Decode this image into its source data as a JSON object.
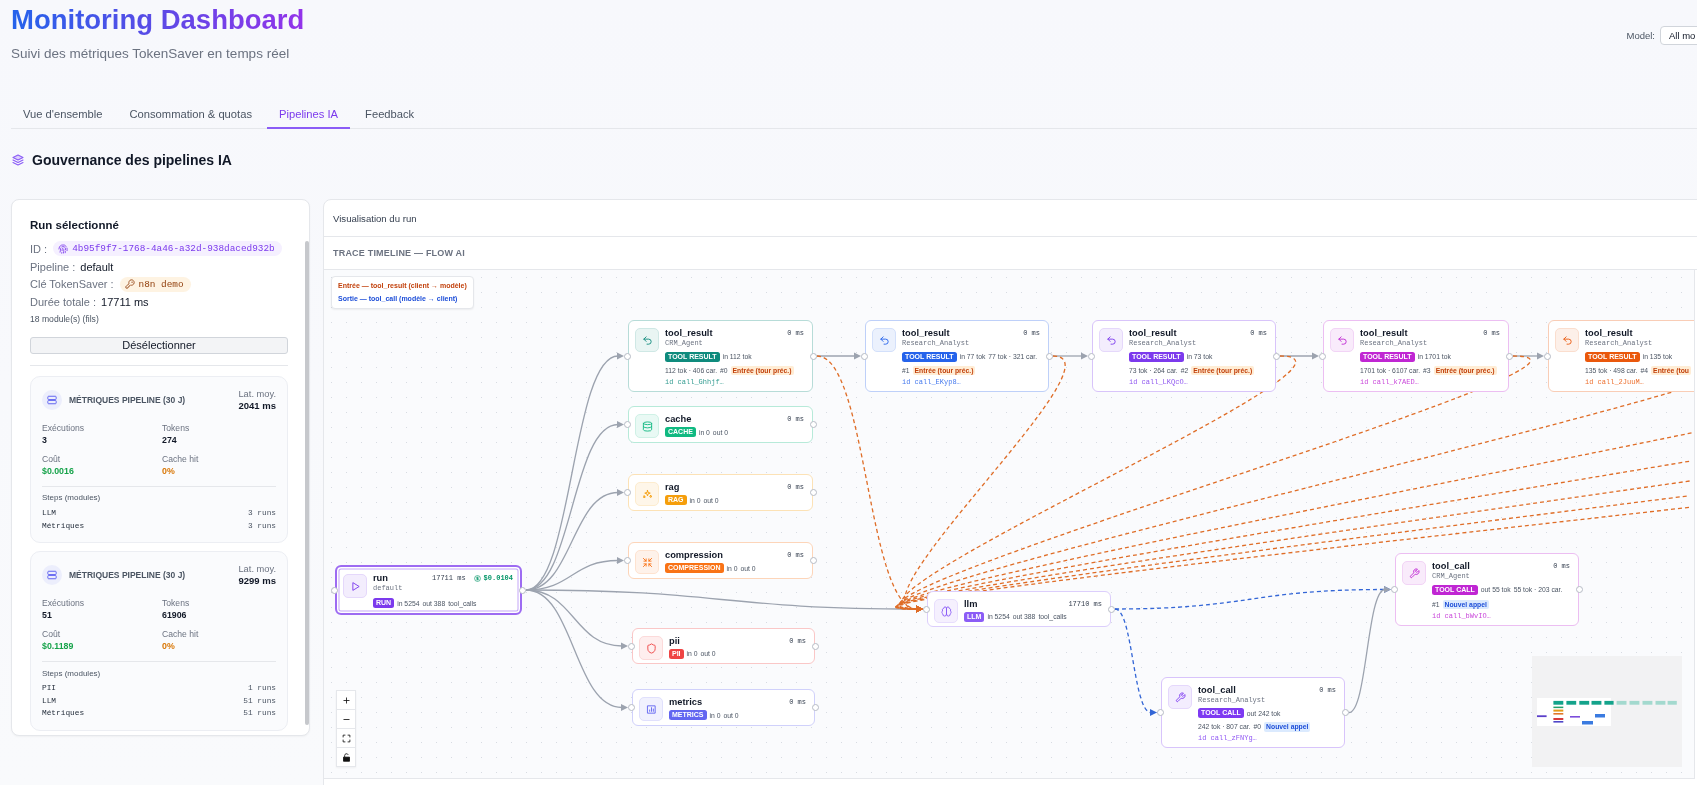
{
  "header": {
    "title": "Monitoring Dashboard",
    "subtitle": "Suivi des métriques TokenSaver en temps réel",
    "model_filter": {
      "label": "Model:",
      "value": "All mo"
    }
  },
  "tabs": [
    {
      "label": "Vue d'ensemble",
      "selected": false
    },
    {
      "label": "Consommation & quotas",
      "selected": false
    },
    {
      "label": "Pipelines IA",
      "selected": true
    },
    {
      "label": "Feedback",
      "selected": false
    }
  ],
  "section": {
    "title": "Gouvernance des pipelines IA"
  },
  "run_panel": {
    "title": "Run sélectionné",
    "fields": [
      {
        "kind": "id",
        "label": "ID :",
        "value": "4b95f9f7-1768-4a46-a32d-938daced932b"
      },
      {
        "kind": "text",
        "label": "Pipeline :",
        "value": "default"
      },
      {
        "kind": "key",
        "label": "Clé TokenSaver :",
        "value": "n8n demo"
      },
      {
        "kind": "text",
        "label": "Durée totale :",
        "value": "17711 ms"
      }
    ],
    "modules_note": "18 module(s) (fils)",
    "deselect_button": "Désélectionner",
    "metric_cards": [
      {
        "title": "MÉTRIQUES PIPELINE (30 J)",
        "latency_label": "Lat. moy.",
        "latency": "2041 ms",
        "stats": [
          {
            "kind": "count",
            "label": "Exécutions",
            "value": "3"
          },
          {
            "kind": "count",
            "label": "Tokens",
            "value": "274"
          },
          {
            "kind": "cost",
            "label": "Coût",
            "value": "$0.0016"
          },
          {
            "kind": "rate",
            "label": "Cache hit",
            "value": "0%"
          }
        ],
        "steps_label": "Steps (modules)",
        "steps": [
          {
            "name": "LLM",
            "runs": "3 runs"
          },
          {
            "name": "Métriques",
            "runs": "3 runs"
          }
        ]
      },
      {
        "title": "MÉTRIQUES PIPELINE (30 J)",
        "latency_label": "Lat. moy.",
        "latency": "9299 ms",
        "stats": [
          {
            "kind": "count",
            "label": "Exécutions",
            "value": "51"
          },
          {
            "kind": "count",
            "label": "Tokens",
            "value": "61906"
          },
          {
            "kind": "cost",
            "label": "Coût",
            "value": "$0.1189"
          },
          {
            "kind": "rate",
            "label": "Cache hit",
            "value": "0%"
          }
        ],
        "steps_label": "Steps (modules)",
        "steps": [
          {
            "name": "PII",
            "runs": "1 runs"
          },
          {
            "name": "LLM",
            "runs": "51 runs"
          },
          {
            "name": "Métriques",
            "runs": "51 runs"
          }
        ]
      }
    ]
  },
  "viz_panel": {
    "title": "Visualisation du run",
    "trace_title": "TRACE TIMELINE — FLOW AI",
    "legend": [
      {
        "kind": "input",
        "text": "Entrée — tool_result (client → modèle)"
      },
      {
        "kind": "output",
        "text": "Sortie — tool_call (modèle → client)"
      }
    ],
    "nodes": [
      {
        "kind": "run",
        "title": "run",
        "subtitle": "default",
        "duration": "17711 ms",
        "cost": "$0.0104",
        "badge": "RUN",
        "stats": [
          "in 5254",
          "out 388",
          "tool_calls"
        ],
        "color": "#7c3aed",
        "selected": true
      },
      {
        "kind": "tool_result",
        "title": "tool_result",
        "subtitle": "CRM_Agent",
        "duration": "0 ms",
        "badge": "TOOL RESULT",
        "stats": [
          "in 112 tok",
          "112 tok · 406 car.",
          "#0"
        ],
        "tag": "Entrée (tour préc.)",
        "call_id": "id call_Ghhjf…",
        "color": "#0f8b7d",
        "selected": false
      },
      {
        "kind": "tool_result",
        "title": "tool_result",
        "subtitle": "Research_Analyst",
        "duration": "0 ms",
        "badge": "TOOL RESULT",
        "stats": [
          "in 77 tok",
          "77 tok · 321 car.",
          "#1"
        ],
        "tag": "Entrée (tour préc.)",
        "call_id": "id call_EKyp8…",
        "color": "#2563eb",
        "selected": false
      },
      {
        "kind": "tool_result",
        "title": "tool_result",
        "subtitle": "Research_Analyst",
        "duration": "0 ms",
        "badge": "TOOL RESULT",
        "stats": [
          "in 73 tok",
          "73 tok · 264 car.",
          "#2"
        ],
        "tag": "Entrée (tour préc.)",
        "call_id": "id call_LKQcO…",
        "color": "#7c3aed",
        "selected": false
      },
      {
        "kind": "tool_result",
        "title": "tool_result",
        "subtitle": "Research_Analyst",
        "duration": "0 ms",
        "badge": "TOOL RESULT",
        "stats": [
          "in 1701 tok",
          "1701 tok · 6107 car.",
          "#3"
        ],
        "tag": "Entrée (tour préc.)",
        "call_id": "id call_k7AED…",
        "color": "#c026d3",
        "selected": false
      },
      {
        "kind": "tool_result",
        "title": "tool_result",
        "subtitle": "Research_Analyst",
        "badge": "TOOL RESULT",
        "stats": [
          "in 135 tok",
          "135 tok · 498 car.",
          "#4"
        ],
        "tag": "Entrée (tou",
        "call_id": "id call_2JuuM…",
        "color": "#ea580c",
        "selected": false
      },
      {
        "kind": "cache",
        "title": "cache",
        "duration": "0 ms",
        "badge": "CACHE",
        "stats": [
          "in 0",
          "out 0"
        ],
        "color": "#10b981",
        "selected": false
      },
      {
        "kind": "rag",
        "title": "rag",
        "duration": "0 ms",
        "badge": "RAG",
        "stats": [
          "in 0",
          "out 0"
        ],
        "color": "#f59e0b",
        "selected": false
      },
      {
        "kind": "compression",
        "title": "compression",
        "duration": "0 ms",
        "badge": "COMPRESSION",
        "stats": [
          "in 0",
          "out 0"
        ],
        "color": "#f97316",
        "selected": false
      },
      {
        "kind": "pii",
        "title": "pii",
        "duration": "0 ms",
        "badge": "PII",
        "stats": [
          "in 0",
          "out 0"
        ],
        "color": "#ef4444",
        "selected": false
      },
      {
        "kind": "metrics",
        "title": "metrics",
        "duration": "0 ms",
        "badge": "METRICS",
        "stats": [
          "in 0",
          "out 0"
        ],
        "color": "#6366f1",
        "selected": false
      },
      {
        "kind": "llm",
        "title": "llm",
        "duration": "17710 ms",
        "badge": "LLM",
        "stats": [
          "in 5254",
          "out 388",
          "tool_calls"
        ],
        "color": "#8b5cf6",
        "selected": false
      },
      {
        "kind": "tool_call",
        "title": "tool_call",
        "subtitle": "CRM_Agent",
        "duration": "0 ms",
        "badge": "TOOL CALL",
        "stats": [
          "out 55 tok",
          "55 tok · 203 car.",
          "#1"
        ],
        "tag": "Nouvel appel",
        "call_id": "id call_bWvIO…",
        "color": "#c026d3",
        "selected": false
      },
      {
        "kind": "tool_call",
        "title": "tool_call",
        "subtitle": "Research_Analyst",
        "duration": "0 ms",
        "badge": "TOOL CALL",
        "stats": [
          "out 242 tok",
          "242 tok · 807 car.",
          "#0"
        ],
        "tag": "Nouvel appel",
        "call_id": "id call_zFNYg…",
        "color": "#7e3af2",
        "selected": false
      }
    ],
    "edges": [
      {
        "kind": "flow"
      },
      {
        "kind": "flow"
      },
      {
        "kind": "flow"
      },
      {
        "kind": "flow"
      },
      {
        "kind": "flow"
      },
      {
        "kind": "flow"
      },
      {
        "kind": "flow"
      },
      {
        "kind": "flow"
      },
      {
        "kind": "flow"
      },
      {
        "kind": "flow"
      },
      {
        "kind": "flow"
      },
      {
        "kind": "input"
      },
      {
        "kind": "input"
      },
      {
        "kind": "input"
      },
      {
        "kind": "input"
      },
      {
        "kind": "input"
      },
      {
        "kind": "input"
      },
      {
        "kind": "input"
      },
      {
        "kind": "input"
      },
      {
        "kind": "input"
      },
      {
        "kind": "input"
      },
      {
        "kind": "output"
      },
      {
        "kind": "output"
      },
      {
        "kind": "flow"
      }
    ]
  }
}
